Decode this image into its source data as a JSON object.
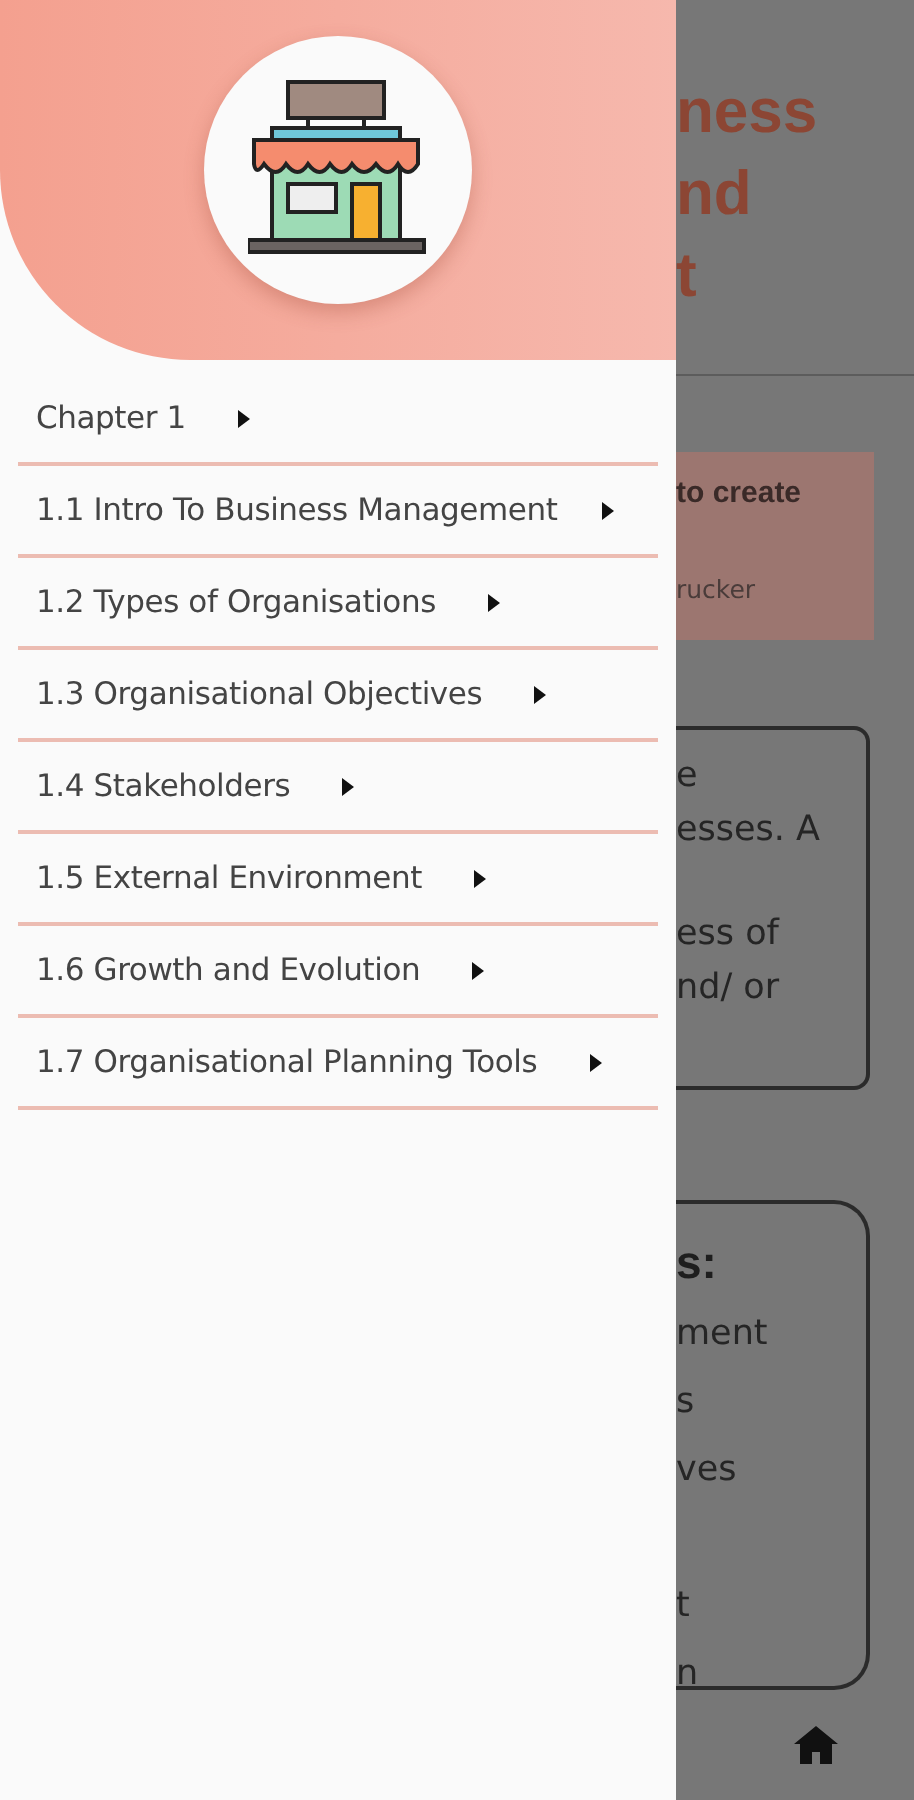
{
  "drawer": {
    "items": [
      {
        "label": "Chapter 1"
      },
      {
        "label": "1.1 Intro To Business Management"
      },
      {
        "label": "1.2 Types of Organisations"
      },
      {
        "label": "1.3 Organisational Objectives"
      },
      {
        "label": "1.4 Stakeholders"
      },
      {
        "label": "1.5 External Environment"
      },
      {
        "label": "1.6 Growth and Evolution"
      },
      {
        "label": "1.7 Organisational Planning Tools"
      }
    ]
  },
  "background_page": {
    "title_lines": [
      "ness",
      "nd",
      "t"
    ],
    "quote": {
      "text": "to create",
      "author": "rucker"
    },
    "intro_card": {
      "paragraphs": [
        [
          "e",
          "esses. A"
        ],
        [
          "ess of",
          "nd/ or"
        ]
      ]
    },
    "contents_card": {
      "heading": "s:",
      "groups": [
        [
          "ment",
          "s",
          "ves"
        ],
        [
          "t",
          "n"
        ]
      ]
    }
  }
}
